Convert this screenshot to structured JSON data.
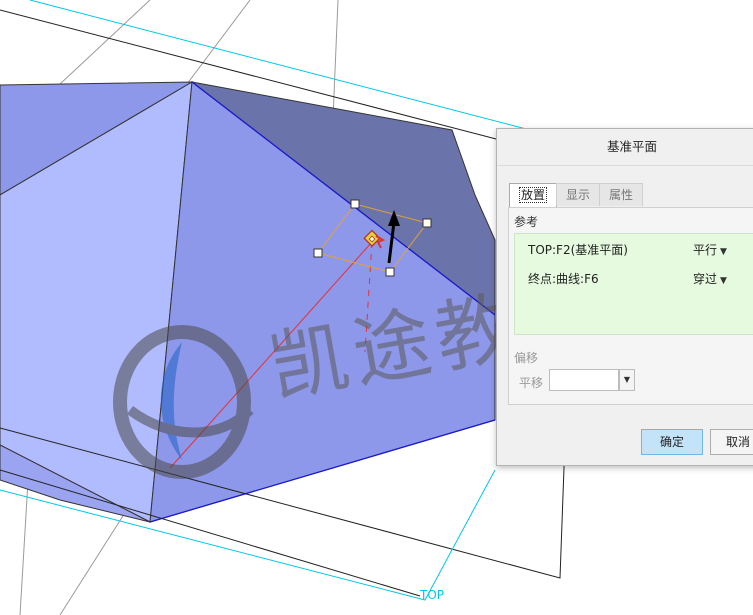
{
  "viewport": {
    "plane_label": "TOP",
    "colors": {
      "solid_light": "#b1bcff",
      "solid_mid": "#8e98ea",
      "solid_dark": "#6a74aa",
      "datum_plane": "#00c8e8",
      "edge_blue": "#1a1ad0",
      "arrow": "#000000",
      "handle_outline": "#e3a236",
      "curve_red": "#e83030"
    }
  },
  "watermark": {
    "text": "凯途教育",
    "color": "#555555"
  },
  "dialog": {
    "title": "基准平面",
    "tabs": [
      {
        "label": "放置",
        "active": true
      },
      {
        "label": "显示",
        "active": false
      },
      {
        "label": "属性",
        "active": false
      }
    ],
    "references_label": "参考",
    "references": [
      {
        "name": "TOP:F2(基准平面)",
        "type": "平行"
      },
      {
        "name": "终点:曲线:F6",
        "type": "穿过"
      }
    ],
    "offset_label": "偏移",
    "shift_label": "平移",
    "shift_value": "",
    "ok_label": "确定",
    "cancel_label": "取消"
  }
}
